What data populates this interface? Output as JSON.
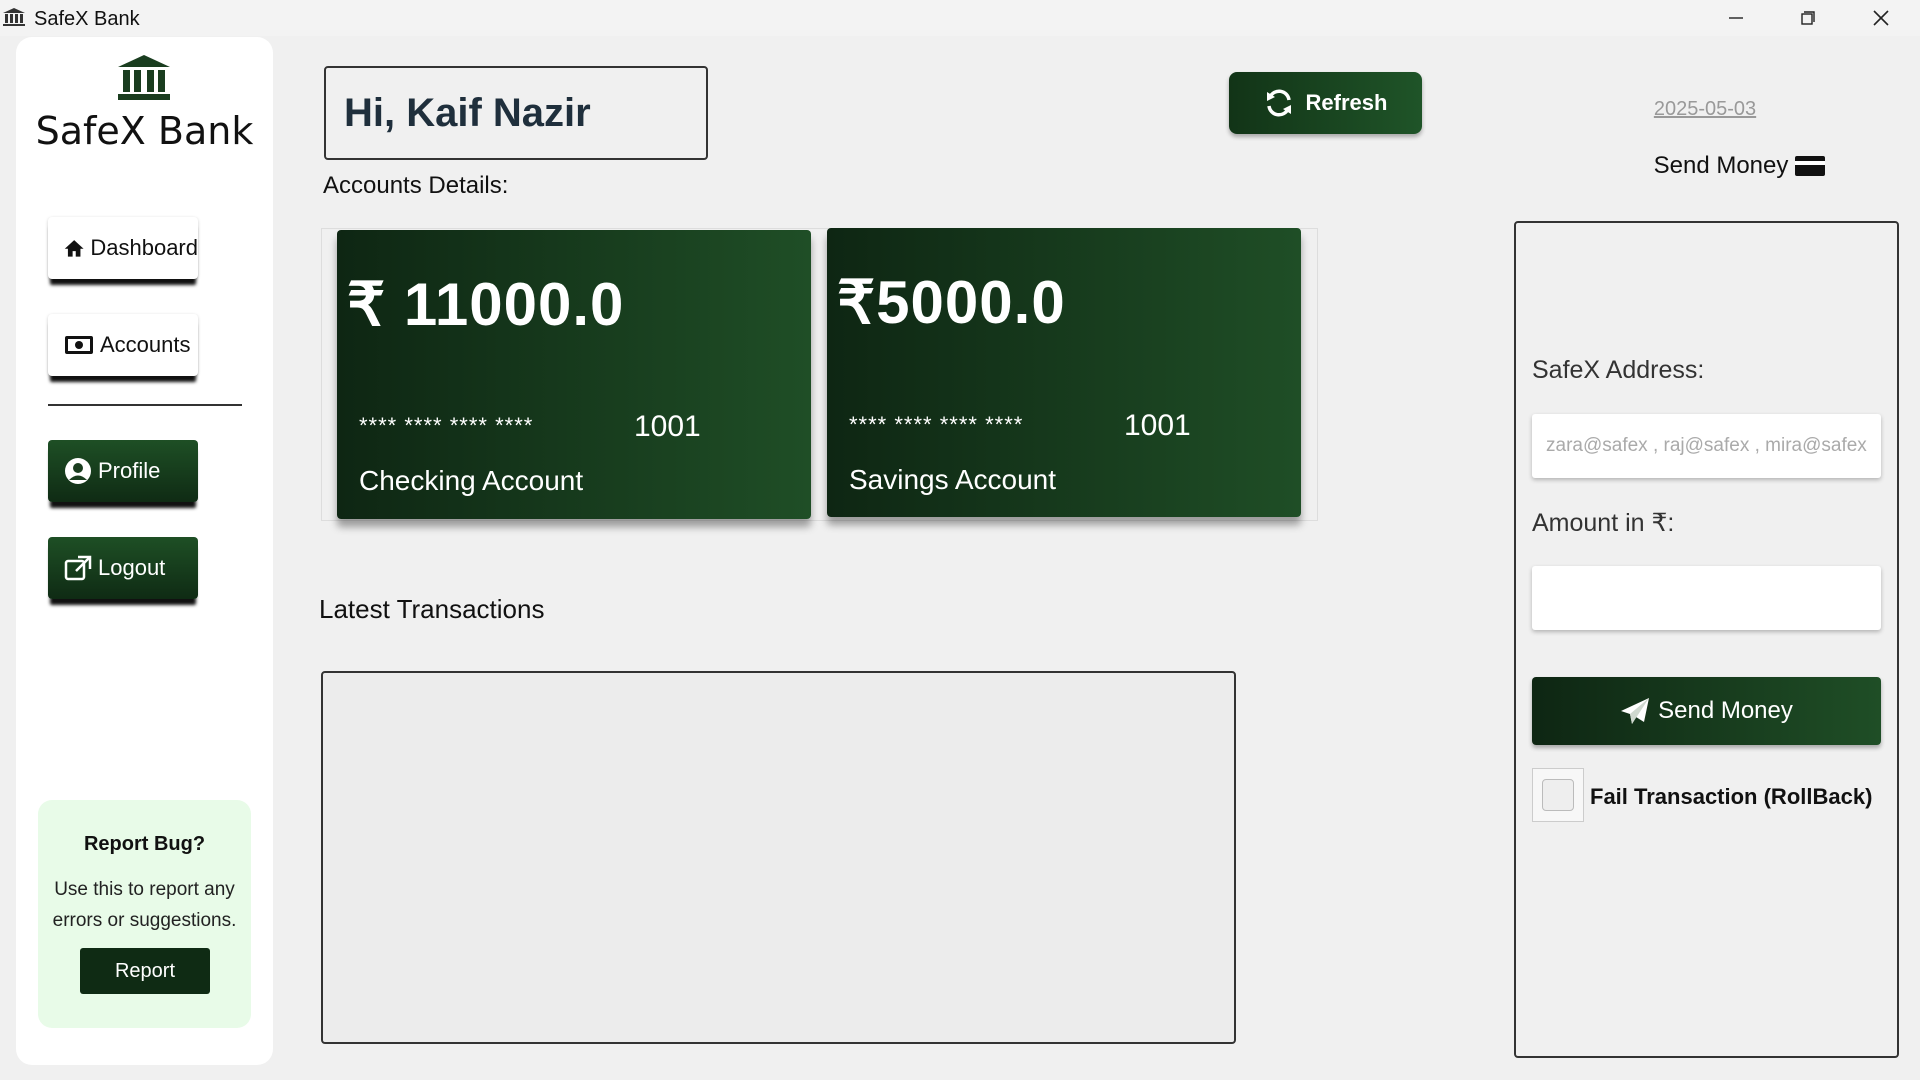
{
  "window": {
    "title": "SafeX Bank"
  },
  "sidebar": {
    "brand": "SafeX Bank",
    "nav": {
      "dashboard": "Dashboard",
      "accounts": "Accounts",
      "profile": "Profile",
      "logout": "Logout"
    },
    "report": {
      "title": "Report Bug?",
      "description": "Use this to report any errors or suggestions.",
      "button": "Report"
    }
  },
  "header": {
    "greeting": "Hi, Kaif Nazir",
    "refresh_label": "Refresh",
    "date": "2025-05-03",
    "send_money_title": "Send Money"
  },
  "accounts": {
    "label": "Accounts Details:",
    "cards": [
      {
        "amount": "₹ 11000.0",
        "masked_number": "**** **** **** ****",
        "last_digits": "1001",
        "type": "Checking Account"
      },
      {
        "amount": "₹5000.0",
        "masked_number": "**** **** **** ****",
        "last_digits": "1001",
        "type": "Savings Account"
      }
    ]
  },
  "transactions": {
    "title": "Latest Transactions"
  },
  "send_panel": {
    "address_label": "SafeX Address:",
    "address_placeholder": "zara@safex , raj@safex , mira@safex",
    "amount_label": "Amount in ₹:",
    "amount_value": "",
    "send_button": "Send Money",
    "fail_label": "Fail Transaction (RollBack)"
  },
  "colors": {
    "primary_dark": "#0e2613",
    "primary": "#1f4e26",
    "bug_card_bg": "#e8fbe8"
  }
}
